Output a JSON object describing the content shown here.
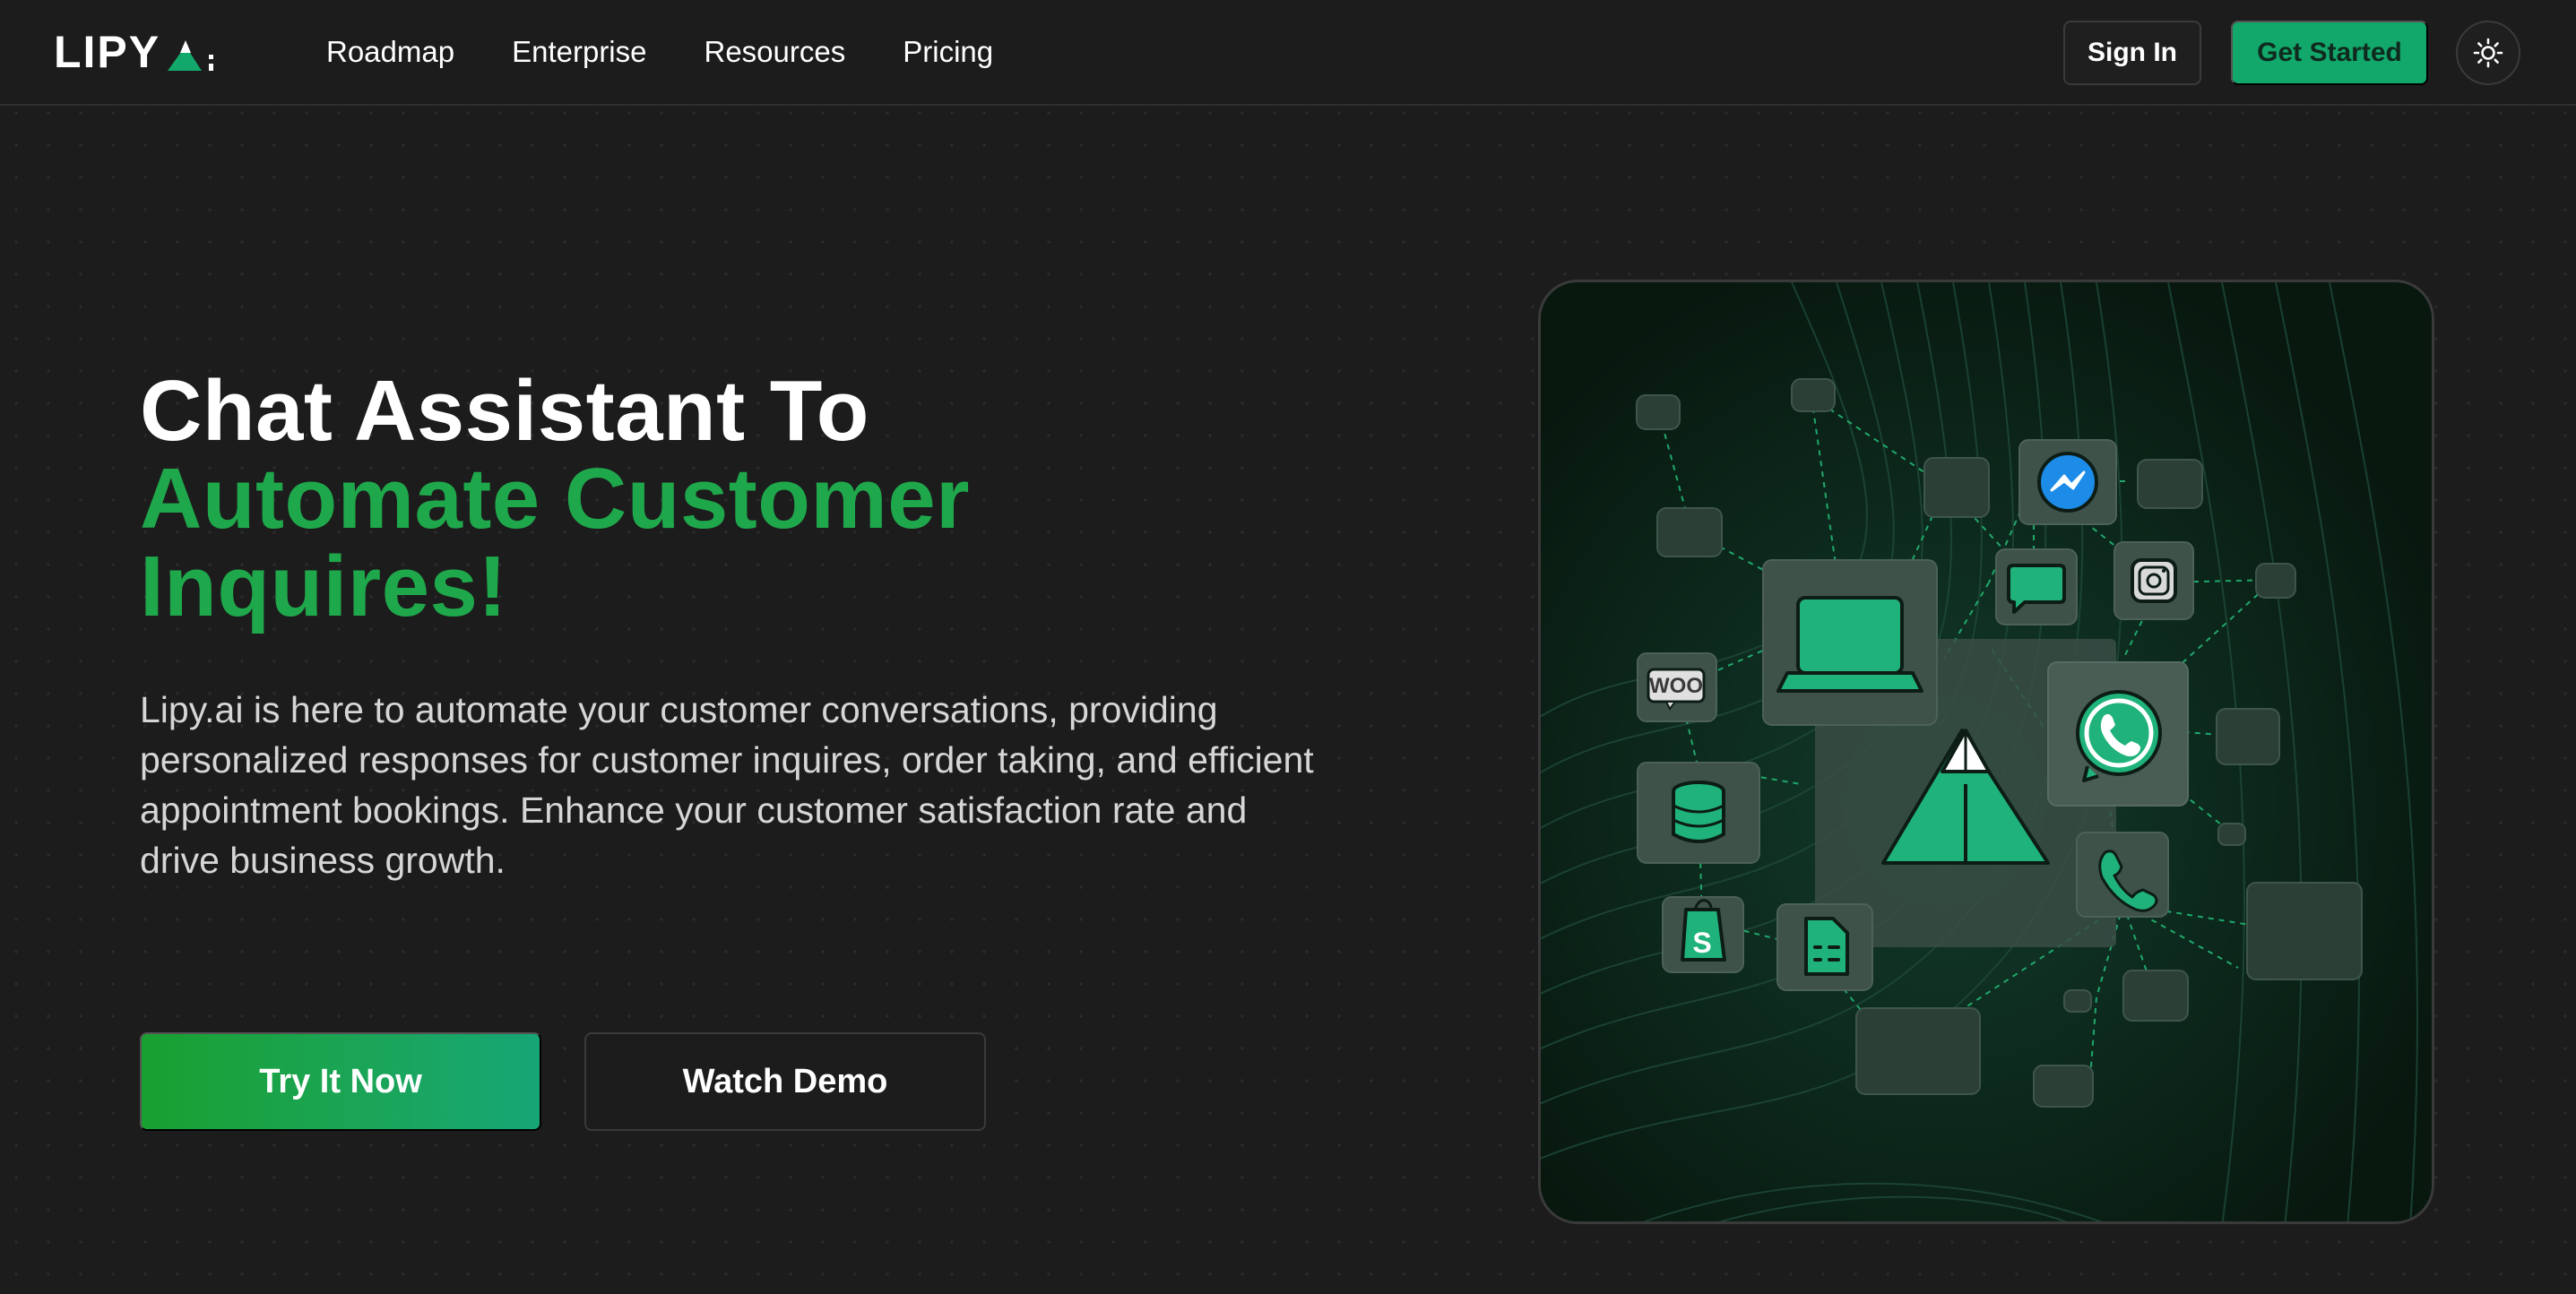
{
  "brand": {
    "logo_text": "LIPY",
    "logo_suffix": "ai",
    "accent_color": "#13a86b",
    "hero_green": "#1fa84b"
  },
  "nav": {
    "links": [
      "Roadmap",
      "Enterprise",
      "Resources",
      "Pricing"
    ],
    "sign_in": "Sign In",
    "get_started": "Get Started",
    "theme_icon": "sun-icon"
  },
  "hero": {
    "title_line1": "Chat Assistant To",
    "title_line2": "Automate Customer",
    "title_line3": "Inquires!",
    "description": "Lipy.ai is here to automate your customer conversations, providing personalized responses for customer inquires, order taking, and efficient appointment bookings. Enhance your customer satisfaction rate and drive business growth.",
    "primary_cta": "Try It Now",
    "secondary_cta": "Watch Demo"
  },
  "illustration": {
    "woo_label": "WOO",
    "icons": [
      "laptop-icon",
      "lipy-logo-icon",
      "messenger-icon",
      "chat-bubble-icon",
      "instagram-icon",
      "whatsapp-icon",
      "woocommerce-icon",
      "database-icon",
      "shopify-icon",
      "spreadsheet-icon",
      "phone-icon"
    ]
  }
}
